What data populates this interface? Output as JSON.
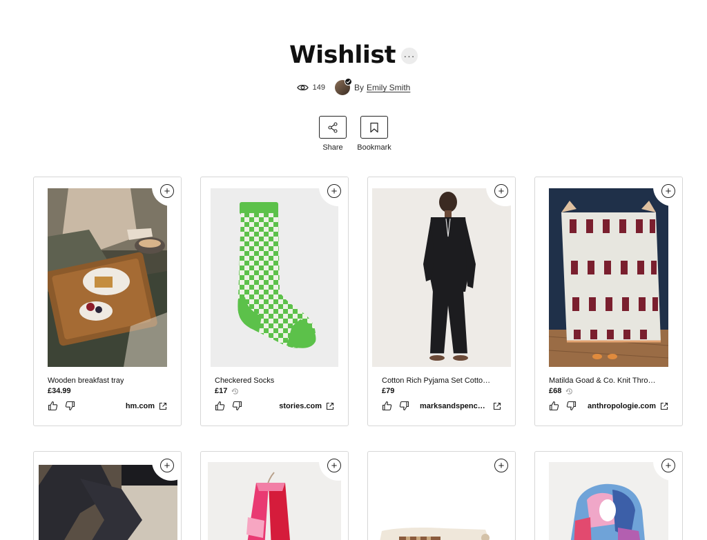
{
  "page": {
    "title": "Wishlist",
    "more_glyph": "···",
    "views": "149",
    "by_label": "By",
    "author": "Emily Smith"
  },
  "actions": {
    "share_label": "Share",
    "bookmark_label": "Bookmark"
  },
  "icons": {
    "views": "eye-icon",
    "share": "share-icon",
    "bookmark": "bookmark-icon",
    "add": "plus-circle-icon",
    "like": "thumbs-up-icon",
    "dislike": "thumbs-down-icon",
    "price_history": "history-icon",
    "external": "external-link-icon",
    "verified": "verified-check-icon"
  },
  "items": [
    {
      "name": "Wooden breakfast tray",
      "price": "£34.99",
      "store": "hm.com",
      "image": "breakfast-tray-photo"
    },
    {
      "name": "Checkered Socks",
      "price": "£17",
      "store": "stories.com",
      "image": "green-checkered-sock-photo"
    },
    {
      "name": "Cotton Rich Pyjama Set Cotton Rich…",
      "price": "£79",
      "store": "marksandspencer.c…",
      "image": "black-pyjama-set-photo"
    },
    {
      "name": "Matilda Goad & Co. Knit Throw Blan…",
      "price": "£68",
      "store": "anthropologie.com",
      "image": "knit-throw-blanket-photo"
    }
  ],
  "items_row2": [
    {
      "image": "ribbed-tights-photo"
    },
    {
      "image": "pink-scarf-photo"
    },
    {
      "image": "gift-box-photo"
    },
    {
      "image": "blue-check-scarf-photo"
    }
  ],
  "colors": {
    "text": "#111111",
    "border": "#d6d6d6",
    "sock_green": "#5cc14a",
    "blanket_red": "#7a1f2e",
    "wall_navy": "#1f3049"
  }
}
